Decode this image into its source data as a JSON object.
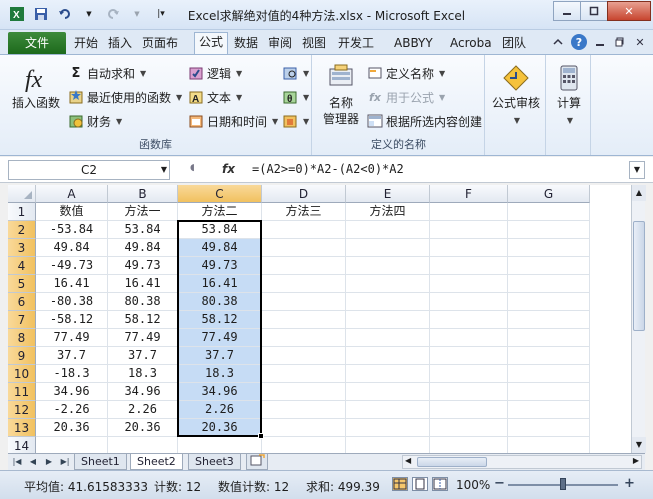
{
  "window": {
    "title": "Excel求解绝对值的4种方法.xlsx - Microsoft Excel"
  },
  "menu": {
    "file": "文件",
    "tabs": [
      "开始",
      "插入",
      "页面布局",
      "公式",
      "数据",
      "审阅",
      "视图",
      "开发工具",
      "ABBYY",
      "Acroba",
      "团队"
    ],
    "active_tab": "公式"
  },
  "ribbon": {
    "insert_function": "插入函数",
    "autosum": "自动求和",
    "recent": "最近使用的函数",
    "financial": "财务",
    "logical": "逻辑",
    "text": "文本",
    "datetime": "日期和时间",
    "library_label": "函数库",
    "name_manager_1": "名称",
    "name_manager_2": "管理器",
    "define_name": "定义名称",
    "use_in_formula": "用于公式",
    "create_from_selection": "根据所选内容创建",
    "names_label": "定义的名称",
    "formula_audit": "公式审核",
    "calculation": "计算"
  },
  "formula_bar": {
    "name_box": "C2",
    "fx": "fx",
    "formula": "=(A2>=0)*A2-(A2<0)*A2"
  },
  "grid": {
    "columns": [
      "A",
      "B",
      "C",
      "D",
      "E",
      "F",
      "G"
    ],
    "rows": [
      "1",
      "2",
      "3",
      "4",
      "5",
      "6",
      "7",
      "8",
      "9",
      "10",
      "11",
      "12",
      "13",
      "14"
    ],
    "headers": [
      "数值",
      "方法一",
      "方法二",
      "方法三",
      "方法四"
    ],
    "values": [
      "-53.84",
      "49.84",
      "-49.73",
      "16.41",
      "-80.38",
      "-58.12",
      "77.49",
      "37.7",
      "-18.3",
      "34.96",
      "-2.26",
      "20.36"
    ],
    "method1": [
      "53.84",
      "49.84",
      "49.73",
      "16.41",
      "80.38",
      "58.12",
      "77.49",
      "37.7",
      "18.3",
      "34.96",
      "2.26",
      "20.36"
    ],
    "method2": [
      "53.84",
      "49.84",
      "49.73",
      "16.41",
      "80.38",
      "58.12",
      "77.49",
      "37.7",
      "18.3",
      "34.96",
      "2.26",
      "20.36"
    ],
    "selected_column": "C",
    "active_cell": "C2"
  },
  "sheets": {
    "tabs": [
      "Sheet1",
      "Sheet2",
      "Sheet3"
    ],
    "active": "Sheet2"
  },
  "status": {
    "average": "平均值: 41.61583333",
    "count": "计数: 12",
    "numeric_count": "数值计数: 12",
    "sum": "求和: 499.39",
    "zoom": "100%"
  },
  "colors": {
    "file_tab": "#1d6a1c",
    "selection_fill": "#c6dcf5",
    "header_highlight": "#f1c15f"
  }
}
